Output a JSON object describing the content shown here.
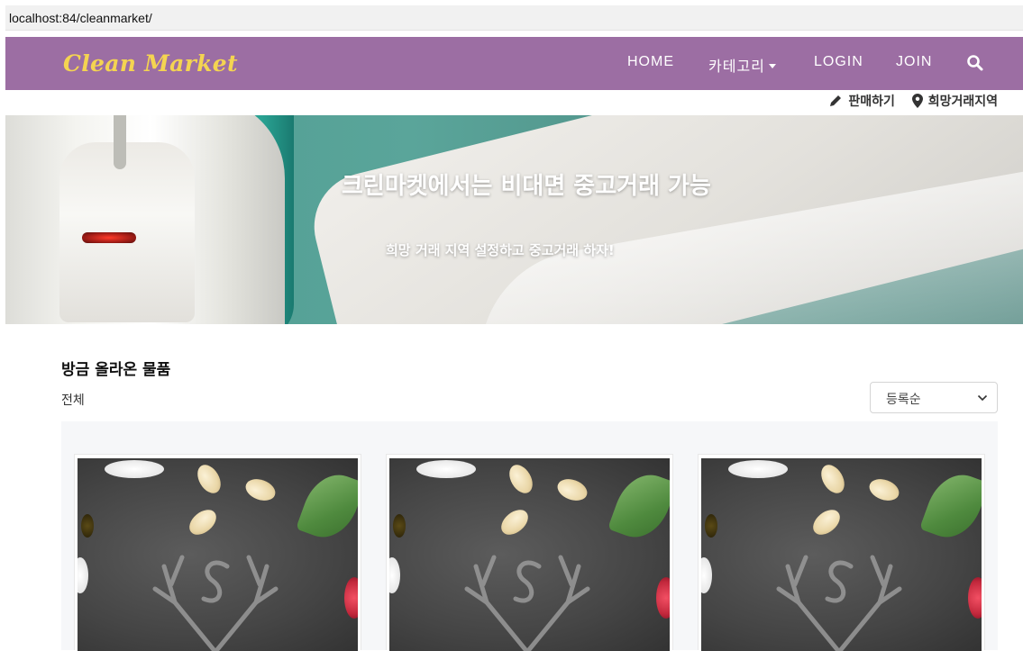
{
  "browser": {
    "url": "localhost:84/cleanmarket/"
  },
  "navbar": {
    "brand": "Clean Market",
    "items": [
      {
        "label": "HOME"
      },
      {
        "label": "카테고리"
      },
      {
        "label": "LOGIN"
      },
      {
        "label": "JOIN"
      }
    ],
    "search_icon": "search-icon",
    "color": "#9c6ea3",
    "brand_color": "#f4d451"
  },
  "sublinks": {
    "sell": "판매하기",
    "region": "희망거래지역"
  },
  "hero": {
    "title": "크린마켓에서는 비대면 중고거래 가능",
    "subtitle": "희망 거래 지역 설정하고 중고거래 하자!"
  },
  "products": {
    "section_title": "방금 올라온 물품",
    "filter_label": "전체",
    "sort": {
      "selected": "등록순"
    },
    "card_count_visible": 3
  }
}
